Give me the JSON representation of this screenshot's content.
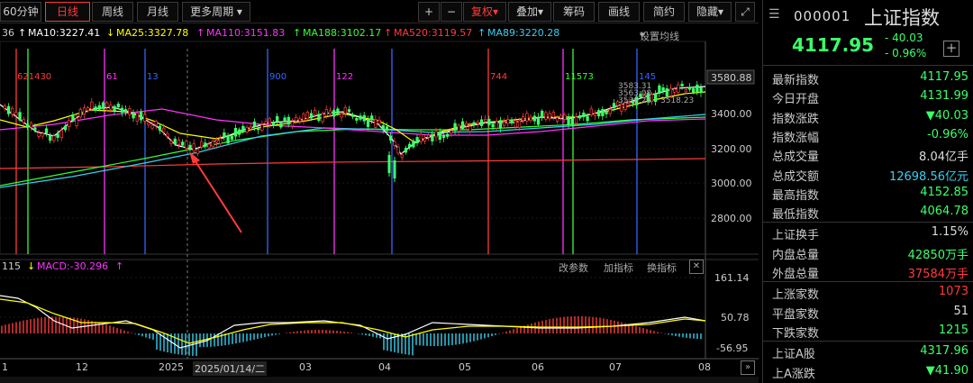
{
  "toolbar": {
    "period_60": "60分钟",
    "day": "日线",
    "week": "周线",
    "month": "月线",
    "more": "更多周期",
    "plus": "+",
    "minus": "−",
    "fuquan": "复权",
    "diejia": "叠加",
    "chouma": "筹码",
    "huaxian": "画线",
    "jianyue": "简约",
    "yincang": "隐藏"
  },
  "ma_legend": {
    "prefix": "36",
    "ma10": "MA10:3227.41",
    "ma25": "MA25:3327.78",
    "ma110": "MA110:3151.83",
    "ma188": "MA188:3102.17",
    "ma520": "MA520:3119.57",
    "ma89": "MA89:3220.28",
    "settings": "设置均线"
  },
  "price_axis": [
    "3580.88",
    "3400.00",
    "3200.00",
    "3000.00",
    "2800.00"
  ],
  "hline_labels": [
    "3583.31",
    "3563.08",
    "3536.28",
    "3518.23"
  ],
  "vline_labels": [
    "621430",
    "61",
    "13",
    "900",
    "122",
    "744",
    "11573",
    "145"
  ],
  "macd_legend": {
    "prefix": "115",
    "macd": "MACD:-30.296",
    "edit": "改参数",
    "add": "加指标",
    "switch": "换指标"
  },
  "macd_axis": [
    "161.14",
    "50.78",
    "-56.95"
  ],
  "xaxis": [
    "1",
    "12",
    "2025",
    "2025/01/14/二",
    "03",
    "04",
    "05",
    "06",
    "07",
    "08"
  ],
  "header": {
    "code": "000001",
    "name": "上证指数",
    "price": "4117.95",
    "change": "- 40.03",
    "change_pct": "- 0.96%"
  },
  "quotes": [
    {
      "label": "最新指数",
      "value": "4117.95",
      "color": "green"
    },
    {
      "label": "今日开盘",
      "value": "4131.99",
      "color": "green"
    },
    {
      "label": "指数涨跌",
      "value": "▼40.03",
      "color": "green"
    },
    {
      "label": "指数涨幅",
      "value": "-0.96%",
      "color": "green"
    },
    {
      "label": "总成交量",
      "value": "8.04亿手",
      "color": "white"
    },
    {
      "label": "总成交额",
      "value": "12698.56亿元",
      "color": "cyan"
    },
    {
      "label": "最高指数",
      "value": "4152.85",
      "color": "green"
    },
    {
      "label": "最低指数",
      "value": "4064.78",
      "color": "green"
    },
    {
      "label": "上证换手",
      "value": "1.15%",
      "color": "white"
    },
    {
      "label": "内盘总量",
      "value": "42850万手",
      "color": "green"
    },
    {
      "label": "外盘总量",
      "value": "37584万手",
      "color": "red"
    },
    {
      "label": "上涨家数",
      "value": "1073",
      "color": "red"
    },
    {
      "label": "平盘家数",
      "value": "51",
      "color": "white"
    },
    {
      "label": "下跌家数",
      "value": "1215",
      "color": "green"
    },
    {
      "label": "上证A股",
      "value": "4317.96",
      "color": "green"
    },
    {
      "label": "上A涨跌",
      "value": "▼41.90",
      "color": "green"
    }
  ],
  "colors": {
    "up": "#ff3b3b",
    "down": "#3cff6a",
    "ma10": "#ffffff",
    "ma25": "#ffff00",
    "ma110": "#ff33ff",
    "ma188": "#33ff33",
    "ma520": "#ff3b3b",
    "ma89": "#36d0f0"
  }
}
